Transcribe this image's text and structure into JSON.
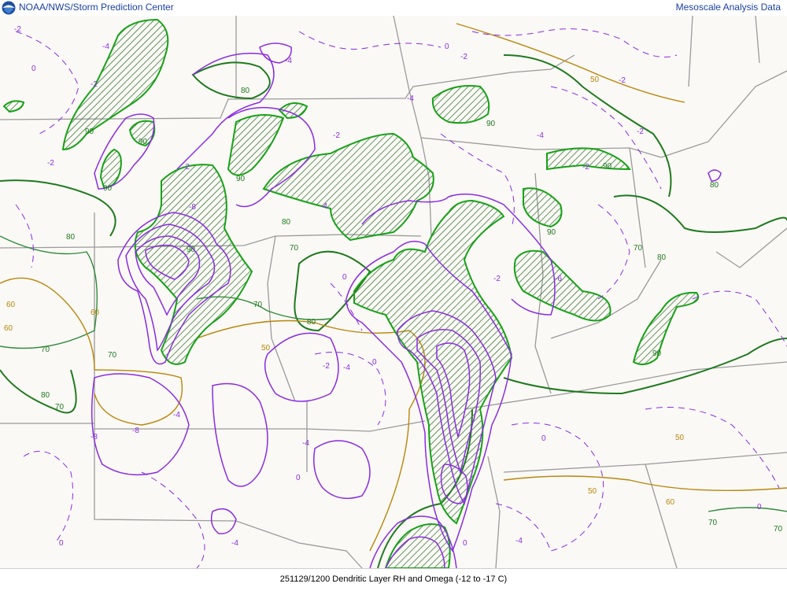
{
  "header": {
    "agency": "NOAA/NWS/Storm Prediction Center",
    "product_title": "Mesoscale Analysis Data",
    "logo_icon": "noaa-logo-icon"
  },
  "footer": {
    "caption": "251129/1200 Dendritic Layer RH and Omega (-12 to -17 C)"
  },
  "legend_colors": {
    "rh_high": "#16a216",
    "rh_mid": "#2e8b3a",
    "rh_low": "#b8860b",
    "omega": "#8a2be2",
    "hatch": "#3a8a3a",
    "borders": "#9a9a9a"
  },
  "map_labels": {
    "rh": [
      "90",
      "90",
      "90",
      "90",
      "90",
      "90",
      "90",
      "90",
      "90",
      "80",
      "80",
      "80",
      "80",
      "80",
      "80",
      "80",
      "70",
      "70",
      "70",
      "70",
      "70",
      "70",
      "70",
      "70",
      "60",
      "60",
      "60",
      "60",
      "50",
      "50",
      "50",
      "50"
    ],
    "omega": [
      "-2",
      "-2",
      "-2",
      "-2",
      "-2",
      "-2",
      "-2",
      "-2",
      "-2",
      "-2",
      "-4",
      "-4",
      "-4",
      "-4",
      "-4",
      "-4",
      "-4",
      "-4",
      "-6",
      "-8",
      "-8",
      "-8",
      "-2",
      "0",
      "0",
      "0",
      "0",
      "0",
      "0",
      "0",
      "0",
      "0",
      "-4",
      "-4"
    ]
  }
}
